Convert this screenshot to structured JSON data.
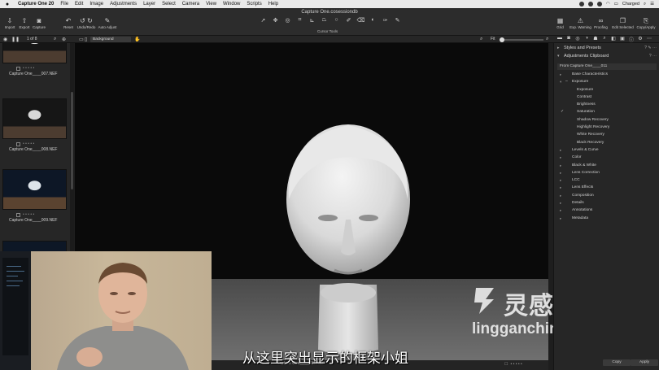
{
  "menubar": {
    "apple": "",
    "items": [
      "Capture One 20",
      "File",
      "Edit",
      "Image",
      "Adjustments",
      "Layer",
      "Select",
      "Camera",
      "View",
      "Window",
      "Scripts",
      "Help"
    ],
    "status": {
      "charged": "Charged",
      "battery": ""
    }
  },
  "window": {
    "title": "Capture One.cosessiondb"
  },
  "toolbar": {
    "left_tools": [
      {
        "label": "Import",
        "icon": "import-icon"
      },
      {
        "label": "Export",
        "icon": "export-icon"
      },
      {
        "label": "Capture",
        "icon": "camera-icon"
      }
    ],
    "edit_tools": [
      {
        "label": "Reset",
        "icon": "reset-icon"
      },
      {
        "label": "Undo/Redo",
        "icon": "undo-icon"
      },
      {
        "label": "Auto Adjust",
        "icon": "wand-icon"
      }
    ],
    "cursor_tools_label": "Cursor Tools",
    "right_tools": [
      {
        "label": "Grid",
        "icon": "grid-icon"
      },
      {
        "label": "Exp. Warning",
        "icon": "warning-icon"
      },
      {
        "label": "Proofing",
        "icon": "glasses-icon"
      },
      {
        "label": "Edit Selected",
        "icon": "edit-selected-icon"
      },
      {
        "label": "Copy/Apply",
        "icon": "copy-apply-icon"
      }
    ]
  },
  "subbar": {
    "counter": "1 of 8",
    "background_select": "Background",
    "fit": "Fit"
  },
  "filmstrip": {
    "items": [
      {
        "name": "Capture One____007.NEF",
        "stars": "• • • • •"
      },
      {
        "name": "Capture One____008.NEF",
        "stars": "• • • • •"
      },
      {
        "name": "Capture One____009.NEF",
        "stars": "• • • • •"
      }
    ]
  },
  "viewer": {
    "caption": "Capture One____011.NEF",
    "rating": "• • • • •"
  },
  "subtitle": "从这里突出显示的框架小姐",
  "watermark": {
    "cn": "灵感中国",
    "en": "lingganchina.com"
  },
  "panel": {
    "styles_presets": "Styles and Presets",
    "adjustments_clipboard": "Adjustments Clipboard",
    "from_label": "From Capture One____011",
    "items": [
      {
        "label": "Base Characteristics",
        "level": "top",
        "arrow": "▸"
      },
      {
        "label": "Exposure",
        "level": "top",
        "arrow": "▾",
        "check": "–"
      },
      {
        "label": "Exposure",
        "level": "sub"
      },
      {
        "label": "Contrast",
        "level": "sub"
      },
      {
        "label": "Brightness",
        "level": "sub"
      },
      {
        "label": "Saturation",
        "level": "sub",
        "check": "✓"
      },
      {
        "label": "Shadow Recovery",
        "level": "sub"
      },
      {
        "label": "Highlight Recovery",
        "level": "sub"
      },
      {
        "label": "White Recovery",
        "level": "sub"
      },
      {
        "label": "Black Recovery",
        "level": "sub"
      },
      {
        "label": "Levels & Curve",
        "level": "top",
        "arrow": "▸"
      },
      {
        "label": "Color",
        "level": "top",
        "arrow": "▸"
      },
      {
        "label": "Black & White",
        "level": "top",
        "arrow": "▸"
      },
      {
        "label": "Lens Correction",
        "level": "top",
        "arrow": "▸"
      },
      {
        "label": "LCC",
        "level": "top",
        "arrow": "▸"
      },
      {
        "label": "Lens Effects",
        "level": "top",
        "arrow": "▸"
      },
      {
        "label": "Composition",
        "level": "top",
        "arrow": "▸"
      },
      {
        "label": "Details",
        "level": "top",
        "arrow": "▸"
      },
      {
        "label": "Annotations",
        "level": "top",
        "arrow": "▸"
      },
      {
        "label": "Metadata",
        "level": "top",
        "arrow": "▸"
      }
    ],
    "copy_label": "Copy",
    "apply_label": "Apply"
  },
  "colors": {
    "panel_bg": "#262626",
    "viewer_bg": "#0a0a0a",
    "menubar_bg": "#e9e9e9"
  }
}
